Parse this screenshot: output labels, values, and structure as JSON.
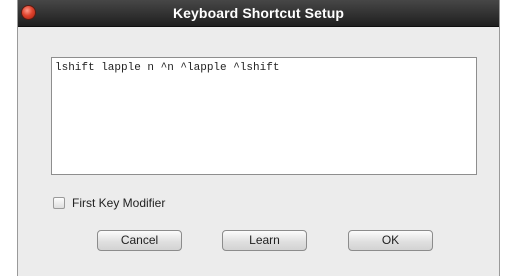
{
  "window": {
    "title": "Keyboard Shortcut Setup"
  },
  "shortcut": {
    "value": "lshift lapple n ^n ^lapple ^lshift"
  },
  "options": {
    "first_key_modifier_label": "First Key Modifier",
    "first_key_modifier_checked": false
  },
  "buttons": {
    "cancel_label": "Cancel",
    "learn_label": "Learn",
    "ok_label": "OK"
  },
  "colors": {
    "titlebar": "#2b2b2b",
    "window_bg": "#ececec",
    "close_button": "#e0442e"
  }
}
